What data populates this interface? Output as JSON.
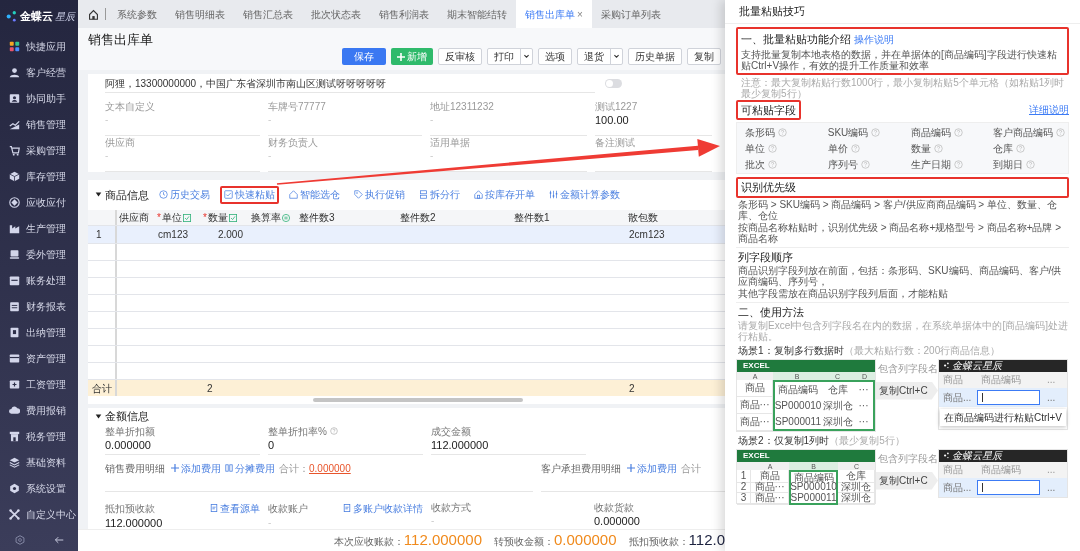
{
  "sidebar": {
    "logo": {
      "brand": "金蝶云",
      "product": "星辰"
    },
    "items": [
      {
        "label": "快捷应用"
      },
      {
        "label": "客户经营"
      },
      {
        "label": "协同助手"
      },
      {
        "label": "销售管理"
      },
      {
        "label": "采购管理"
      },
      {
        "label": "库存管理"
      },
      {
        "label": "应收应付"
      },
      {
        "label": "生产管理"
      },
      {
        "label": "委外管理"
      },
      {
        "label": "账务处理"
      },
      {
        "label": "财务报表"
      },
      {
        "label": "出纳管理"
      },
      {
        "label": "资产管理"
      },
      {
        "label": "工资管理"
      },
      {
        "label": "费用报销"
      },
      {
        "label": "税务管理"
      },
      {
        "label": "基础资料"
      },
      {
        "label": "系统设置"
      },
      {
        "label": "自定义中心"
      }
    ]
  },
  "tabs": [
    {
      "label": "系统参数",
      "selected": false
    },
    {
      "label": "销售明细表",
      "selected": false
    },
    {
      "label": "销售汇总表",
      "selected": false
    },
    {
      "label": "批次状态表",
      "selected": false
    },
    {
      "label": "销售利润表",
      "selected": false
    },
    {
      "label": "期末智能结转",
      "selected": false
    },
    {
      "label": "销售出库单",
      "selected": true,
      "close_mark": "×"
    },
    {
      "label": "采购订单列表",
      "selected": false
    }
  ],
  "page_title": "销售出库单",
  "toolbar": [
    {
      "label": "保存",
      "kind": "primary"
    },
    {
      "label": "新增",
      "kind": "add"
    },
    {
      "label": "反审核",
      "kind": "default"
    },
    {
      "label": "打印",
      "kind": "split"
    },
    {
      "label": "选项",
      "kind": "default"
    },
    {
      "label": "退货",
      "kind": "split"
    },
    {
      "label": "历史单据",
      "kind": "default"
    },
    {
      "label": "复制",
      "kind": "default"
    }
  ],
  "header_form": {
    "contact_line": "阿狸，13300000000，中国广东省深圳市南山区测试呀呀呀呀呀",
    "toggle": {
      "on": false
    },
    "fields": [
      {
        "label": "文本自定义",
        "value": "-"
      },
      {
        "label": "车牌号77777",
        "value": "-"
      },
      {
        "label": "地址12311232",
        "value": "-"
      },
      {
        "label": "测试1227",
        "value": "100.00"
      },
      {
        "label": "供应商",
        "value": "-"
      },
      {
        "label": "财务负责人",
        "value": "-"
      },
      {
        "label": "适用单据",
        "value": "-"
      },
      {
        "label": "备注测试"
      }
    ]
  },
  "goods": {
    "title": "商品信息",
    "expanded": true,
    "actions": [
      {
        "label": "历史交易",
        "highlighted": false
      },
      {
        "label": "快速粘贴",
        "highlighted": true
      },
      {
        "label": "智能选仓",
        "highlighted": false
      },
      {
        "label": "执行促销",
        "highlighted": false
      },
      {
        "label": "拆分行",
        "highlighted": false
      },
      {
        "label": "按库存开单",
        "highlighted": false
      },
      {
        "label": "金额计算参数",
        "highlighted": false
      }
    ],
    "columns": [
      {
        "label": "供应商",
        "kind": "plain"
      },
      {
        "label": "单位",
        "required_mark": "*",
        "kind": "editable"
      },
      {
        "label": "数量",
        "required_mark": "*",
        "kind": "editable"
      },
      {
        "label": "换算率",
        "kind": "convert"
      },
      {
        "label": "整件数3",
        "kind": "plain"
      },
      {
        "label": "整件数2",
        "kind": "plain"
      },
      {
        "label": "整件数1",
        "kind": "plain"
      },
      {
        "label": "散包数",
        "kind": "plain"
      }
    ],
    "rows": [
      {
        "index": "1",
        "selected": true,
        "cells": [
          null,
          "cm123",
          "2.000",
          null,
          null,
          null,
          null,
          "2cm123"
        ]
      }
    ],
    "total": {
      "label": "合计",
      "cells": [
        null,
        null,
        "2",
        null,
        null,
        null,
        null,
        "2"
      ]
    }
  },
  "amount": {
    "title": "金额信息",
    "expanded": true,
    "fields": [
      {
        "label": "整单折扣额",
        "value": "0.000000",
        "help": false
      },
      {
        "label": "整单折扣率%",
        "value": "0",
        "help": true
      },
      {
        "label": "成交金额",
        "value": "112.000000",
        "help": false
      }
    ],
    "expense_groups": [
      {
        "label": "销售费用明细",
        "actions": [
          {
            "label": "添加费用",
            "kind": "add"
          },
          {
            "label": "分摊费用",
            "kind": "split"
          }
        ],
        "total_label": "合计：",
        "total_value": "0.000000"
      },
      {
        "label": "客户承担费用明细",
        "actions": [
          {
            "label": "添加费用",
            "kind": "add"
          }
        ],
        "total_label": "合计"
      }
    ],
    "payment": [
      {
        "label": "抵扣预收款",
        "link": "查看源单",
        "value": "112.000000"
      },
      {
        "label": "收款账户",
        "link": "多账户收款详情",
        "value": "-"
      },
      {
        "label": "收款方式",
        "value": "-"
      },
      {
        "label": "收款货款",
        "value": "0.000000"
      }
    ]
  },
  "summary": [
    {
      "label": "本次应收账款：",
      "value": "112.000000",
      "kind": "highlight"
    },
    {
      "label": "转预收金额：",
      "value": "0.000000",
      "kind": "highlight"
    },
    {
      "label": "抵扣预收款：",
      "value": "112.0",
      "kind": "plain"
    }
  ],
  "panel": {
    "title": "批量粘贴技巧",
    "intro": {
      "heading": "一、批量粘贴功能介绍",
      "link": "操作说明",
      "text": "支持批量复制本地表格的数据，并在单据体的[商品编码]字段进行快速粘贴Ctrl+V操作，有效的提升工作质量和效率",
      "highlighted": true
    },
    "note": "注意：最大复制粘贴行数1000行，最小复制粘贴5个单元格（如粘贴1列时最少复制5行）",
    "fields_section": {
      "heading": "可粘贴字段",
      "highlighted": true,
      "link": "详细说明",
      "fields": [
        "条形码",
        "SKU编码",
        "商品编码",
        "客户商品编码",
        "单位",
        "单价",
        "数量",
        "仓库",
        "批次",
        "序列号",
        "生产日期",
        "到期日"
      ]
    },
    "priority": {
      "heading": "识别优先级",
      "highlighted": true,
      "lines": [
        "条形码 > SKU编码 > 商品编码 > 客户/供应商商品编码 > 单位、数量、仓库、仓位",
        "按商品名称粘贴时，识别优先级 > 商品名称+规格型号 > 商品名称+品牌 > 商品名称"
      ]
    },
    "column_order": {
      "heading": "列字段顺序",
      "lines": [
        "商品识别字段列放在前面，包括：条形码、SKU编码、商品编码、客户/供应商编码、序列号，",
        "其他字段需放在商品识别字段列后面，才能粘贴"
      ]
    },
    "usage": {
      "heading": "二、使用方法",
      "hint": "请复制Excel中包含列字段名在内的数据，在系统单据体中的[商品编码]处进行粘贴。",
      "scenes": [
        {
          "title": "场景1：复制多行数据时",
          "note": "（最大粘贴行数：200行商品信息）",
          "callout": "包含列字段名",
          "step": "复制Ctrl+C",
          "excel": {
            "title": "EXCEL",
            "columns": [
              {
                "label": "A",
                "selected": false
              },
              {
                "label": "B",
                "selected": true
              },
              {
                "label": "C",
                "selected": true
              },
              {
                "label": "D",
                "selected": true
              }
            ],
            "rows": [
              [
                "商品",
                "商品编码",
                "仓库",
                "···"
              ],
              [
                "商品···",
                "SP000010",
                "深圳仓",
                "···"
              ],
              [
                "商品···",
                "SP000011",
                "深圳仓",
                "···"
              ]
            ]
          },
          "app": {
            "logo": "金蝶云星辰",
            "header": [
              "商品",
              "商品编码",
              "..."
            ],
            "row": [
              {
                "kind": "text",
                "text": "商品..."
              },
              {
                "kind": "input"
              },
              {
                "kind": "text",
                "text": "..."
              }
            ],
            "tooltip": "在商品编码进行粘贴Ctrl+V"
          }
        },
        {
          "title": "场景2：仅复制1列时",
          "note": "（最少复制5行）",
          "callout": "包含列字段名",
          "step": "复制Ctrl+C",
          "excel": {
            "title": "EXCEL",
            "columns": [
              {
                "selected": false
              },
              {
                "label": "A",
                "selected": false
              },
              {
                "label": "B",
                "selected": true
              },
              {
                "label": "C",
                "selected": false
              }
            ],
            "rows": [
              [
                "1",
                "商品",
                "商品编码",
                "仓库"
              ],
              [
                "2",
                "商品···",
                "SP000010",
                "深圳仓"
              ],
              [
                "3",
                "商品···",
                "SP000011",
                "深圳仓"
              ]
            ]
          },
          "app": {
            "logo": "金蝶云星辰",
            "header": [
              "商品",
              "商品编码",
              "..."
            ],
            "row": [
              {
                "kind": "text",
                "text": "商品..."
              },
              {
                "kind": "input"
              },
              {
                "kind": "text",
                "text": "..."
              }
            ]
          }
        }
      ]
    }
  }
}
